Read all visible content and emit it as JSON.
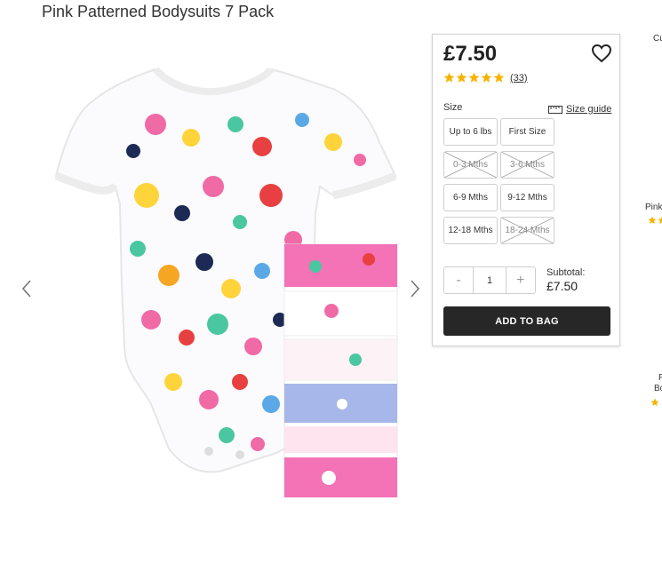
{
  "product": {
    "title": "Pink Patterned Bodysuits 7 Pack",
    "price": "£7.50",
    "rating": 5,
    "review_count": "(33)"
  },
  "size": {
    "label": "Size",
    "guide_label": "Size guide",
    "options": [
      {
        "label": "Up to 6 lbs",
        "available": true
      },
      {
        "label": "First Size",
        "available": true
      },
      {
        "label": "0-3 Mths",
        "available": false
      },
      {
        "label": "3-6 Mths",
        "available": false
      },
      {
        "label": "6-9 Mths",
        "available": true
      },
      {
        "label": "9-12 Mths",
        "available": true
      },
      {
        "label": "12-18 Mths",
        "available": true
      },
      {
        "label": "18-24 Mths",
        "available": false
      }
    ]
  },
  "quantity": {
    "minus": "-",
    "value": "1",
    "plus": "+"
  },
  "subtotal": {
    "label": "Subtotal:",
    "value": "£7.50"
  },
  "add_to_bag": "ADD TO BAG",
  "side_carousel": {
    "top_text": "Cu",
    "item1": "Pink",
    "item2_line1": "P",
    "item2_line2": "Bo"
  },
  "icons": {
    "wishlist": "heart-icon",
    "rating": "star-icon",
    "size_guide": "ruler-icon",
    "prev": "chevron-left-icon",
    "next": "chevron-right-icon",
    "zoom": "zoom-icon"
  },
  "colors": {
    "star": "#f5b301",
    "button_bg": "#272727",
    "garment_pink": "#f06aa6"
  }
}
